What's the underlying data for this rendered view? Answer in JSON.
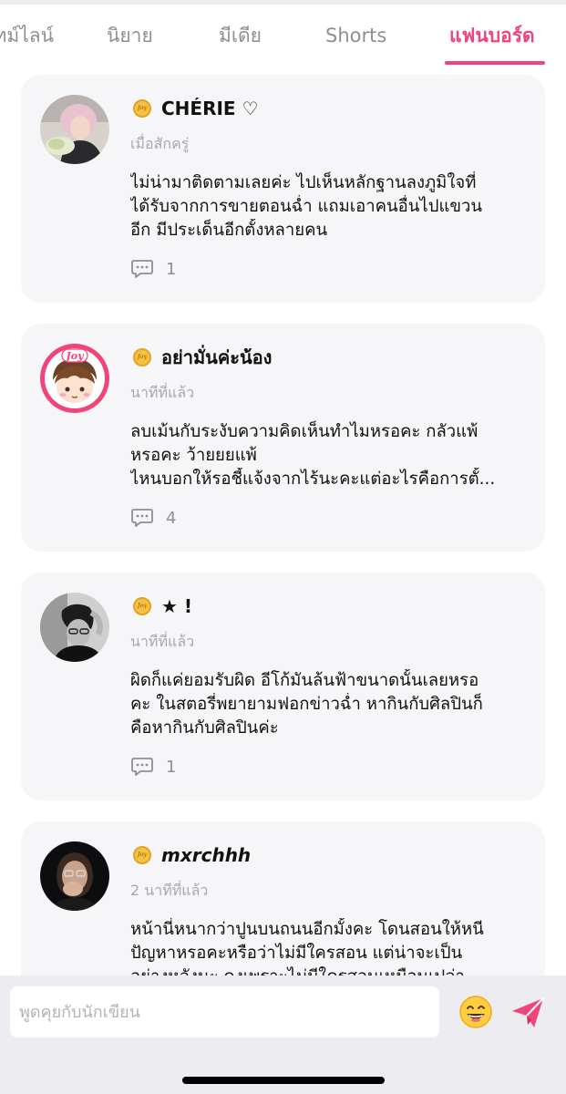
{
  "tabs": [
    {
      "label": "ไทม์ไลน์",
      "active": false
    },
    {
      "label": "นิยาย",
      "active": false
    },
    {
      "label": "มีเดีย",
      "active": false
    },
    {
      "label": "Shorts",
      "active": false
    },
    {
      "label": "แฟนบอร์ด",
      "active": true
    }
  ],
  "colors": {
    "accent": "#f0447a",
    "card_bg": "#f6f6f8",
    "coin": "#f5c242"
  },
  "posts": [
    {
      "name": "CHÉRIE ♡",
      "time": "เมื่อสักครู่",
      "lines": [
        "ไม่น่ามาติดตามเลยค่ะ ไปเห็นหลักฐานลงภูมิใจที่",
        "ได้รับจากการขายตอนฉ่ำ แถมเอาคนอื่นไปแขวน",
        "อีก มีประเด็นอีกตั้งหลายคน"
      ],
      "replies": "1",
      "avatar_icon": "blonde-woman-photo",
      "coin_label": "Joy"
    },
    {
      "name": "อย่ามั่นค่ะน้อง",
      "time": "นาทีที่แล้ว",
      "lines": [
        "ลบเม้นกับระงับความคิดเห็นทำไมหรอคะ กลัวแพ้",
        "หรอคะ ว้ายยยแพ้",
        "ไหนบอกให้รอชี้แจ้งจากไร้นะคะแต่อะไรคือการตั้..."
      ],
      "replies": "4",
      "avatar_icon": "joy-cartoon-boy-avatar",
      "avatar_text": "Joy",
      "coin_label": "Joy"
    },
    {
      "name": "★ !",
      "time": "นาทีที่แล้ว",
      "lines": [
        "ผิดก็แค่ยอมรับผิด อีโก้มันล้นฟ้าขนาดนั้นเลยหรอ",
        "คะ ในสตอรี่พยายามฟอกข่าวฉ่ำ หากินกับศิลปินก็",
        "คือหากินกับศิลปินค่ะ"
      ],
      "replies": "1",
      "avatar_icon": "man-bw-photo",
      "coin_label": "Joy"
    },
    {
      "name": "mxrchhh",
      "time": "2 นาทีที่แล้ว",
      "lines": [
        "หน้านี่หนากว่าปูนบนถนนอีกมั้งคะ โดนสอนให้หนี",
        "ปัญหาหรอคะหรือว่าไม่มีใครสอน แต่น่าจะเป็น",
        "อย่างหลังนะ คงเพราะไม่มีใครสอนเหมือนเปล่า"
      ],
      "replies": "",
      "avatar_icon": "woman-hand-on-face-photo",
      "coin_label": "Joy"
    }
  ],
  "composer": {
    "placeholder": "พูดคุยกับนักเขียน",
    "emoji_icon": "grinning-emoji-icon",
    "send_icon": "paper-plane-send-icon"
  }
}
